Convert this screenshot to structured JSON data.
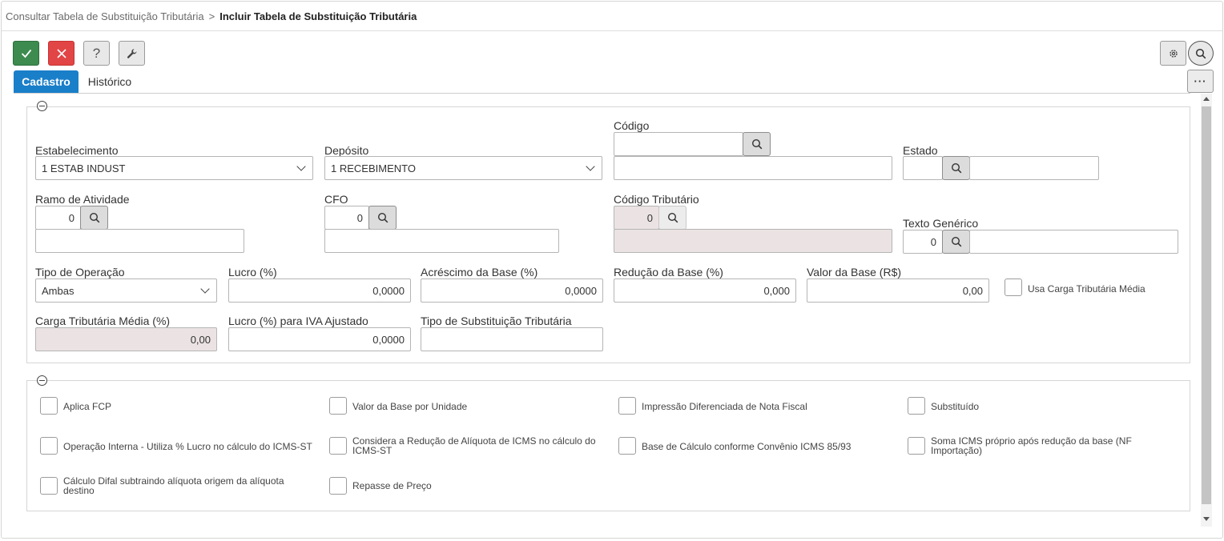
{
  "breadcrumb": {
    "parent": "Consultar Tabela de Substituição Tributária",
    "separator": ">",
    "current": "Incluir Tabela de Substituição Tributária"
  },
  "toolbar": {
    "confirm_icon": "check-icon",
    "cancel_icon": "close-icon",
    "help_label": "?",
    "tools_icon": "wrench-icon",
    "settings_icon": "gear-icon",
    "search_icon": "search-icon",
    "more_label": "···"
  },
  "tabs": [
    {
      "label": "Cadastro",
      "active": true
    },
    {
      "label": "Histórico",
      "active": false
    }
  ],
  "form": {
    "estabelecimento": {
      "label": "Estabelecimento",
      "value": "1 ESTAB INDUST"
    },
    "deposito": {
      "label": "Depósito",
      "value": "1 RECEBIMENTO"
    },
    "codigo": {
      "label": "Código",
      "value": "",
      "description": ""
    },
    "estado": {
      "label": "Estado",
      "value": "",
      "description": ""
    },
    "ramo_atividade": {
      "label": "Ramo de Atividade",
      "value": "0",
      "description": ""
    },
    "cfo": {
      "label": "CFO",
      "value": "0",
      "description": ""
    },
    "codigo_tributario": {
      "label": "Código Tributário",
      "value": "0",
      "description": ""
    },
    "texto_generico": {
      "label": "Texto Genérico",
      "value": "0",
      "description": ""
    },
    "tipo_operacao": {
      "label": "Tipo de Operação",
      "value": "Ambas"
    },
    "lucro": {
      "label": "Lucro (%)",
      "value": "0,0000"
    },
    "acrescimo_base": {
      "label": "Acréscimo da Base (%)",
      "value": "0,0000"
    },
    "reducao_base": {
      "label": "Redução da Base (%)",
      "value": "0,000"
    },
    "valor_base": {
      "label": "Valor da Base (R$)",
      "value": "0,00"
    },
    "usa_carga": {
      "label": "Usa Carga Tributária Média",
      "checked": false
    },
    "carga_media": {
      "label": "Carga Tributária Média (%)",
      "value": "0,00"
    },
    "lucro_iva": {
      "label": "Lucro (%) para IVA Ajustado",
      "value": "0,0000"
    },
    "tipo_substituicao": {
      "label": "Tipo de Substituição Tributária",
      "value": ""
    }
  },
  "options": [
    {
      "label": "Aplica FCP",
      "checked": false
    },
    {
      "label": "Valor da Base por Unidade",
      "checked": false
    },
    {
      "label": "Impressão Diferenciada de Nota Fiscal",
      "checked": false
    },
    {
      "label": "Substituído",
      "checked": false
    },
    {
      "label": "Operação Interna - Utiliza % Lucro no cálculo do ICMS-ST",
      "checked": false
    },
    {
      "label": "Considera a Redução de Alíquota de ICMS no cálculo do ICMS-ST",
      "checked": false
    },
    {
      "label": "Base de Cálculo conforme Convênio ICMS 85/93",
      "checked": false
    },
    {
      "label": "Soma ICMS próprio após redução da base (NF Importação)",
      "checked": false
    },
    {
      "label": "Cálculo Difal subtraindo alíquota origem da alíquota destino",
      "checked": false
    },
    {
      "label": "Repasse de Preço",
      "checked": false
    }
  ],
  "colors": {
    "confirm": "#3d8b4f",
    "cancel": "#e24545",
    "tab_active": "#1a7fc9",
    "disabled_field": "#ebe3e3"
  }
}
